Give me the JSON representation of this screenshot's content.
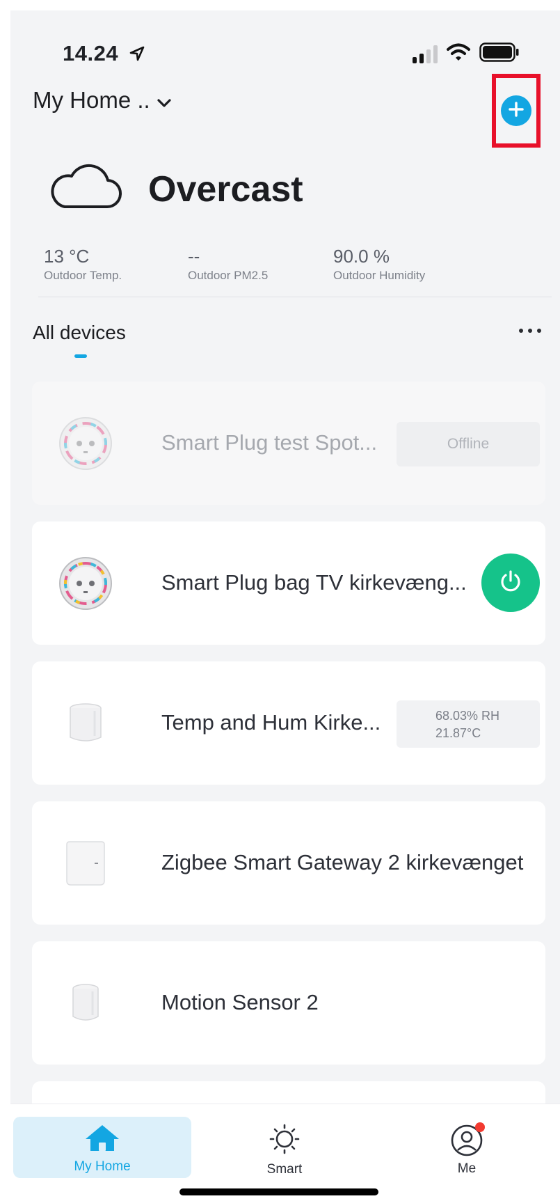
{
  "status_bar": {
    "time": "14.24"
  },
  "header": {
    "home_name": "My Home ..",
    "icons": [
      "chevron-down-icon",
      "add-circle-icon"
    ]
  },
  "weather": {
    "condition": "Overcast",
    "icon": "cloud-icon",
    "stats": [
      {
        "value": "13 °C",
        "label": "Outdoor Temp."
      },
      {
        "value": "--",
        "label": "Outdoor PM2.5"
      },
      {
        "value": "90.0 %",
        "label": "Outdoor Humidity"
      }
    ]
  },
  "devices_section": {
    "title": "All devices"
  },
  "devices": [
    {
      "name": "Smart Plug test Spot...",
      "status": "Offline",
      "icon": "smart-plug-icon"
    },
    {
      "name": "Smart Plug bag TV kirkevæng...",
      "icon": "smart-plug-icon",
      "control": "power-icon"
    },
    {
      "name": "Temp and Hum Kirke...",
      "humidity": "68.03% RH",
      "temperature": "21.87°C",
      "icon": "temp-sensor-icon"
    },
    {
      "name": "Zigbee Smart Gateway 2 kirkevænget",
      "icon": "gateway-icon"
    },
    {
      "name": "Motion Sensor 2",
      "icon": "motion-sensor-icon"
    }
  ],
  "tabbar": {
    "tabs": [
      {
        "label": "My Home",
        "icon": "home-icon",
        "active": true
      },
      {
        "label": "Smart",
        "icon": "sun-icon",
        "active": false
      },
      {
        "label": "Me",
        "icon": "user-icon",
        "active": false
      }
    ]
  },
  "colors": {
    "accent": "#13a6e2",
    "power_on": "#15c38a",
    "highlight_border": "#e8102a",
    "badge": "#f23a30"
  }
}
